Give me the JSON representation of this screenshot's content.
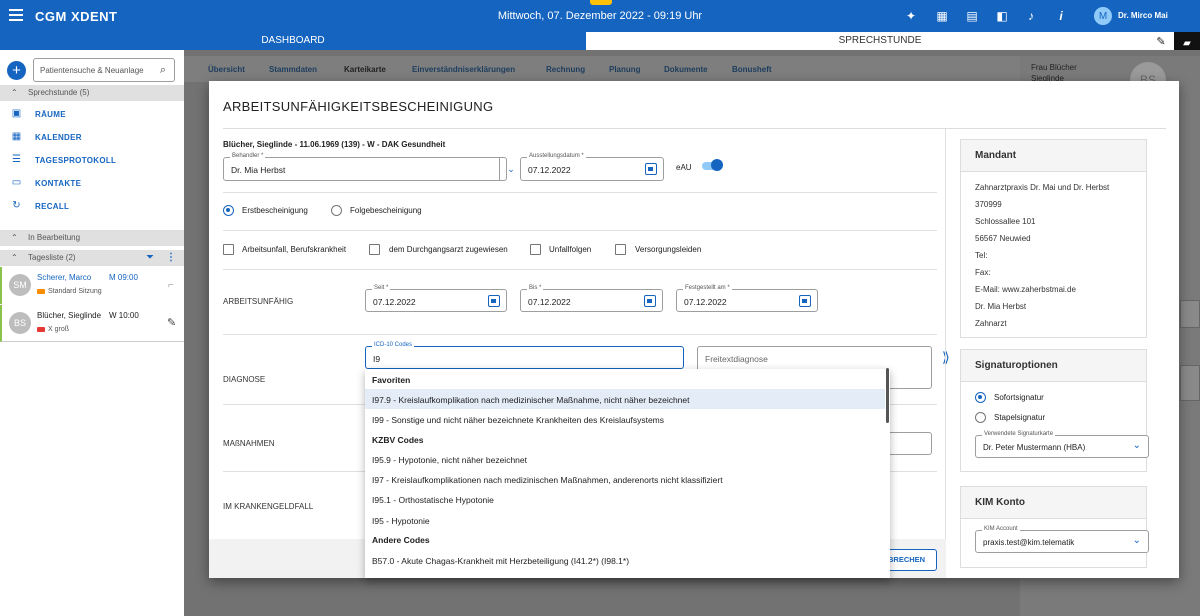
{
  "app": {
    "title": "CGM XDENT",
    "datetime": "Mittwoch, 07. Dezember 2022 - 09:19 Uhr",
    "user_name": "Dr. Mirco Mai",
    "user_initial": "M"
  },
  "top_icons": [
    "magic-wand-icon",
    "calendar-icon",
    "card-reader-icon",
    "phone-book-icon",
    "bell-icon",
    "info-icon"
  ],
  "tabs": {
    "dashboard": "DASHBOARD",
    "sprechstunde": "SPRECHSTUNDE"
  },
  "sidebar": {
    "search_placeholder": "Patientensuche & Neuanlage",
    "section_sprechstunde": "Sprechstunde (5)",
    "nav": [
      {
        "label": "RÄUME",
        "icon": "rooms-icon"
      },
      {
        "label": "KALENDER",
        "icon": "calendar-icon"
      },
      {
        "label": "TAGESPROTOKOLL",
        "icon": "list-icon"
      },
      {
        "label": "KONTAKTE",
        "icon": "contacts-icon"
      },
      {
        "label": "RECALL",
        "icon": "recall-icon"
      }
    ],
    "section_bearbeitung": "In Bearbeitung",
    "section_tagesliste": "Tagesliste (2)",
    "patients": [
      {
        "initials": "SM",
        "name": "Scherer, Marco",
        "time": "M 09:00",
        "note": "Standard Sitzung"
      },
      {
        "initials": "BS",
        "name": "Blücher, Sieglinde",
        "time": "W 10:00",
        "note": "X groß"
      }
    ]
  },
  "background": {
    "menu": [
      "Übersicht",
      "Stammdaten",
      "Karteikarte",
      "Einverständniserklärungen",
      "Rechnung",
      "Planung",
      "Dokumente",
      "Bonusheft"
    ],
    "right_name_1": "Frau Blücher",
    "right_name_2": "Sieglinde",
    "right_initials": "BS"
  },
  "modal": {
    "title": "ARBEITSUNFÄHIGKEITSBESCHEINIGUNG",
    "patient_info": "Blücher, Sieglinde - 11.06.1969 (139) - W - DAK Gesundheit",
    "behandler_label": "Behandler *",
    "behandler_value": "Dr. Mia Herbst",
    "ausstellung_label": "Ausstellungsdatum *",
    "ausstellung_value": "07.12.2022",
    "eau_label": "eAU",
    "eau_on": true,
    "radio_erst": "Erstbescheinigung",
    "radio_folge": "Folgebescheinigung",
    "checks": [
      "Arbeitsunfall, Berufskrankheit",
      "dem Durchgangsarzt zugewiesen",
      "Unfallfolgen",
      "Versorgungsleiden"
    ],
    "row_au": "ARBEITSUNFÄHIG",
    "seit_label": "Seit *",
    "seit_value": "07.12.2022",
    "bis_label": "Bis *",
    "bis_value": "07.12.2022",
    "fest_label": "Festgestellt am *",
    "fest_value": "07.12.2022",
    "row_diag": "DIAGNOSE",
    "icd_label": "ICD-10 Codes",
    "icd_value": "I9",
    "freitext_placeholder": "Freitextdiagnose",
    "row_massn": "MAßNAHMEN",
    "row_kg": "IM KRANKENGELDFALL",
    "cancel_partial": "BRECHEN"
  },
  "mandant": {
    "title": "Mandant",
    "lines": [
      "Zahnarztpraxis Dr. Mai und Dr. Herbst",
      "370999",
      "Schlossallee 101",
      "56567 Neuwied",
      "Tel:",
      "Fax:",
      "E-Mail: www.zaherbstmai.de",
      "Dr. Mia Herbst",
      "Zahnarzt"
    ]
  },
  "signatur": {
    "title": "Signaturoptionen",
    "opt1": "Sofortsignatur",
    "opt2": "Stapelsignatur",
    "karte_label": "Verwendete Signaturkarte",
    "karte_value": "Dr. Peter Mustermann (HBA)"
  },
  "kim": {
    "title": "KIM Konto",
    "label": "KIM Account",
    "value": "praxis.test@kim.telematik"
  },
  "dropdown": {
    "group_fav": "Favoriten",
    "fav": [
      "I97.9 - Kreislaufkomplikation nach medizinischer Maßnahme, nicht näher bezeichnet",
      "I99 - Sonstige und nicht näher bezeichnete Krankheiten des Kreislaufsystems"
    ],
    "group_kzbv": "KZBV Codes",
    "kzbv": [
      "I95.9 - Hypotonie, nicht näher bezeichnet",
      "I97 - Kreislaufkomplikationen nach medizinischen Maßnahmen, anderenorts nicht klassifiziert",
      "I95.1 - Orthostatische Hypotonie",
      "I95 - Hypotonie"
    ],
    "group_andere": "Andere Codes",
    "andere": [
      "B57.0 - Akute Chagas-Krankheit mit Herzbeteiligung (I41.2*) (I98.1*)"
    ]
  }
}
